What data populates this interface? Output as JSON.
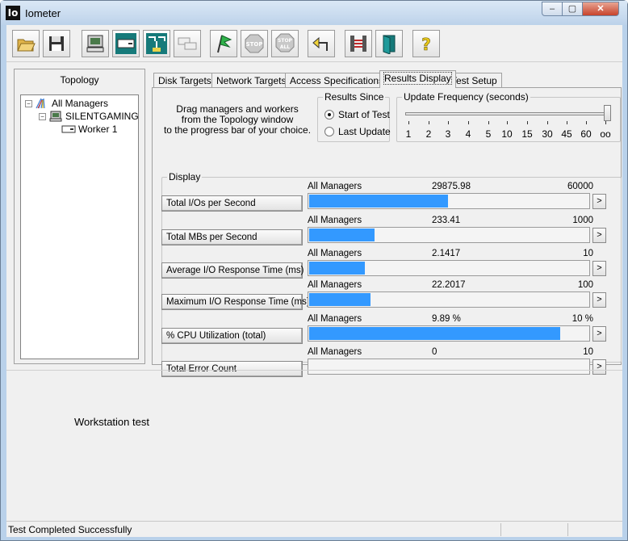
{
  "window": {
    "title": "Iometer",
    "icon_text": "Io",
    "min_glyph": "–",
    "max_glyph": "▢",
    "close_glyph": "✕"
  },
  "toolbar": {
    "buttons": [
      {
        "name": "open-config-button",
        "icon": "open-folder-icon"
      },
      {
        "name": "save-config-button",
        "icon": "floppy-disk-icon"
      },
      {
        "name": "start-manager-button",
        "icon": "computer-icon"
      },
      {
        "name": "start-disk-worker-button",
        "icon": "disk-worker-icon"
      },
      {
        "name": "start-network-worker-button",
        "icon": "network-worker-icon"
      },
      {
        "name": "duplicate-worker-button",
        "icon": "duplicate-icon"
      },
      {
        "name": "start-tests-button",
        "icon": "green-flag-icon"
      },
      {
        "name": "stop-button",
        "icon": "stop-sign-icon",
        "label": "STOP"
      },
      {
        "name": "stop-all-button",
        "icon": "stop-all-icon",
        "label": "STOP",
        "label2": "ALL"
      },
      {
        "name": "reset-workers-button",
        "icon": "reset-arrow-icon"
      },
      {
        "name": "new-window-button",
        "icon": "workers-icon"
      },
      {
        "name": "exit-button",
        "icon": "exit-door-icon"
      },
      {
        "name": "about-button",
        "icon": "question-icon",
        "label": "?"
      }
    ]
  },
  "topology": {
    "title": "Topology",
    "nodes": [
      {
        "label": "All Managers",
        "expander": "−"
      },
      {
        "label": "SILENTGAMING",
        "expander": "−"
      },
      {
        "label": "Worker 1"
      }
    ]
  },
  "tabs": [
    {
      "label": "Disk Targets"
    },
    {
      "label": "Network Targets"
    },
    {
      "label": "Access Specifications"
    },
    {
      "label": "Results Display",
      "active": true
    },
    {
      "label": "Test Setup"
    }
  ],
  "results": {
    "drag_text": [
      "Drag managers and workers",
      "from the Topology window",
      "to the progress bar of your choice."
    ],
    "results_since": {
      "title": "Results Since",
      "options": [
        {
          "label": "Start of Test",
          "selected": true
        },
        {
          "label": "Last Update",
          "selected": false
        }
      ]
    },
    "update_frequency": {
      "title": "Update Frequency (seconds)",
      "ticks": [
        "1",
        "2",
        "3",
        "4",
        "5",
        "10",
        "15",
        "30",
        "45",
        "60",
        "oo"
      ],
      "selected": "oo"
    },
    "display_title": "Display",
    "metrics": [
      {
        "name": "Total I/Os per Second",
        "source": "All Managers",
        "value": "29875.98",
        "max": "60000",
        "fraction": 0.498
      },
      {
        "name": "Total MBs per Second",
        "source": "All Managers",
        "value": "233.41",
        "max": "1000",
        "fraction": 0.233
      },
      {
        "name": "Average I/O Response Time (ms)",
        "source": "All Managers",
        "value": "2.1417",
        "max": "10",
        "fraction": 0.2
      },
      {
        "name": "Maximum I/O Response Time (ms)",
        "source": "All Managers",
        "value": "22.2017",
        "max": "100",
        "fraction": 0.22
      },
      {
        "name": "% CPU Utilization (total)",
        "source": "All Managers",
        "value": "9.89 %",
        "max": "10 %",
        "fraction": 0.9
      },
      {
        "name": "Total Error Count",
        "source": "All Managers",
        "value": "0",
        "max": "10",
        "fraction": 0
      }
    ],
    "arrow_label": ">"
  },
  "lower": {
    "description": "Workstation test"
  },
  "status": {
    "text": "Test Completed Successfully"
  }
}
